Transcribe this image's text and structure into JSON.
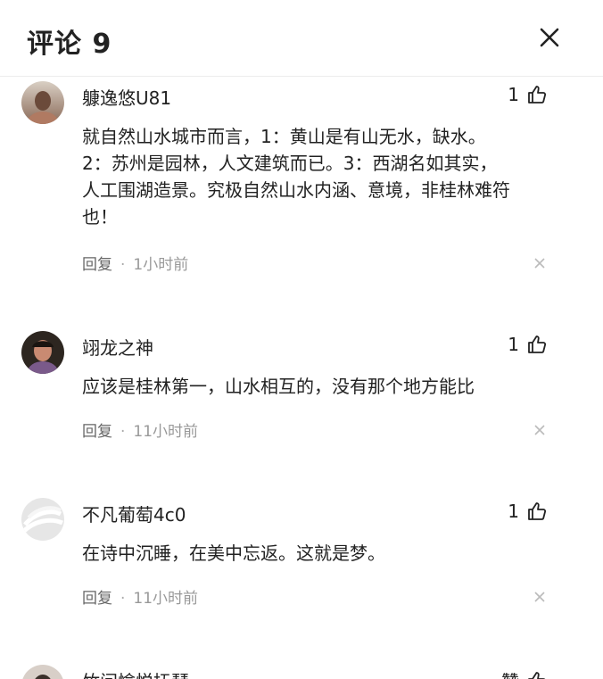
{
  "header": {
    "title": "评论 9"
  },
  "comments": [
    {
      "username": "躿逸悠U81",
      "likes": "1",
      "text_lines": [
        "就自然山水城市而言，1：黄山是有山无水，缺水。",
        "2：苏州是园林，人文建筑而已。3：西湖名如其实，",
        "人工围湖造景。究极自然山水内涵、意境，非桂林难符",
        "也！"
      ],
      "reply_label": "回复",
      "separator": "·",
      "time": "1小时前"
    },
    {
      "username": "翊龙之神",
      "likes": "1",
      "text_lines": [
        "应该是桂林第一，山水相互的，没有那个地方能比"
      ],
      "reply_label": "回复",
      "separator": "·",
      "time": "11小时前"
    },
    {
      "username": "不凡葡萄4c0",
      "likes": "1",
      "text_lines": [
        "在诗中沉睡，在美中忘返。这就是梦。"
      ],
      "reply_label": "回复",
      "separator": "·",
      "time": "11小时前"
    },
    {
      "username": "竹间愉悦抚琴",
      "likes": "赞"
    }
  ]
}
